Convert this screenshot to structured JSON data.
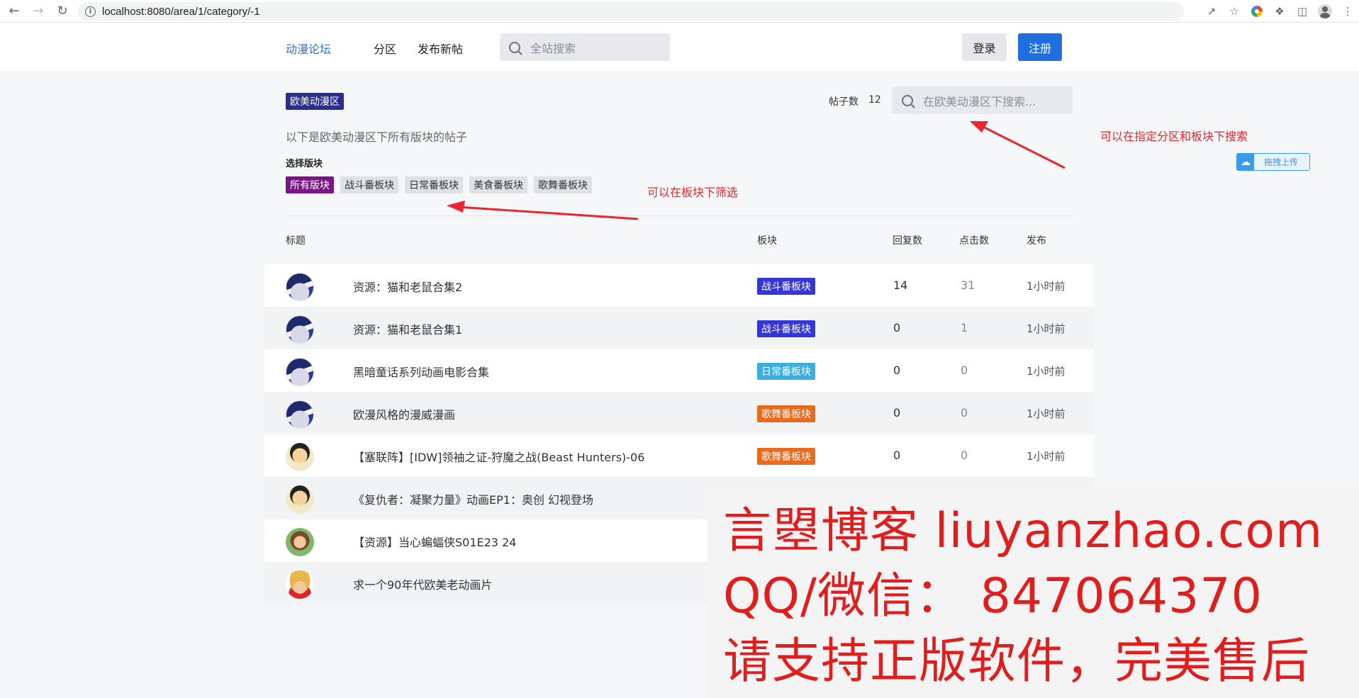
{
  "browser": {
    "url": "localhost:8080/area/1/category/-1"
  },
  "header": {
    "brand": "动漫论坛",
    "nav": [
      "分区",
      "发布新帖"
    ],
    "search_placeholder": "全站搜索",
    "login": "登录",
    "register": "注册"
  },
  "area": {
    "name": "欧美动漫区",
    "post_count_label": "帖子数",
    "post_count": "12",
    "search_placeholder": "在欧美动漫区下搜索...",
    "description": "以下是欧美动漫区下所有版块的帖子",
    "choose_label": "选择版块",
    "filters": [
      "所有版块",
      "战斗番板块",
      "日常番板块",
      "美食番板块",
      "歌舞番板块"
    ],
    "active_filter": "所有版块"
  },
  "table": {
    "headers": [
      "标题",
      "板块",
      "回复数",
      "点击数",
      "发布"
    ],
    "rows": [
      {
        "title": "资源：猫和老鼠合集2",
        "board": "战斗番板块",
        "replies": "14",
        "clicks": "31",
        "time": "1小时前"
      },
      {
        "title": "资源：猫和老鼠合集1",
        "board": "战斗番板块",
        "replies": "0",
        "clicks": "1",
        "time": "1小时前"
      },
      {
        "title": "黑暗童话系列动画电影合集",
        "board": "日常番板块",
        "replies": "0",
        "clicks": "0",
        "time": "1小时前"
      },
      {
        "title": "欧漫风格的漫威漫画",
        "board": "歌舞番板块",
        "replies": "0",
        "clicks": "0",
        "time": "1小时前"
      },
      {
        "title": "【塞联阵】[IDW]领袖之证-狩魔之战(Beast Hunters)-06",
        "board": "歌舞番板块",
        "replies": "0",
        "clicks": "0",
        "time": "1小时前"
      },
      {
        "title": "《复仇者：凝聚力量》动画EP1：奥创 幻视登场"
      },
      {
        "title": "【资源】当心蝙蝠侠S01E23 24"
      },
      {
        "title": "求一个90年代欧美老动画片"
      }
    ]
  },
  "annotations": {
    "filter_note": "可以在板块下筛选",
    "search_note": "可以在指定分区和板块下搜索"
  },
  "upload_button": "拖拽上传",
  "watermark": {
    "line1": "言曌博客 liuyanzhao.com",
    "line2": "QQ/微信：  847064370",
    "line3": "请支持正版软件，完美售后"
  },
  "colors": {
    "brand_blue": "#2f6fdc",
    "register_blue": "#1f6fe0",
    "area_badge": "#2b2f8c",
    "active_filter": "#7d1486",
    "tag_battle": "#3436d6",
    "tag_daily": "#3aaee3",
    "tag_dance": "#ea6b1d",
    "annotation_red": "#e8262c",
    "watermark_red": "#e11e1e"
  }
}
